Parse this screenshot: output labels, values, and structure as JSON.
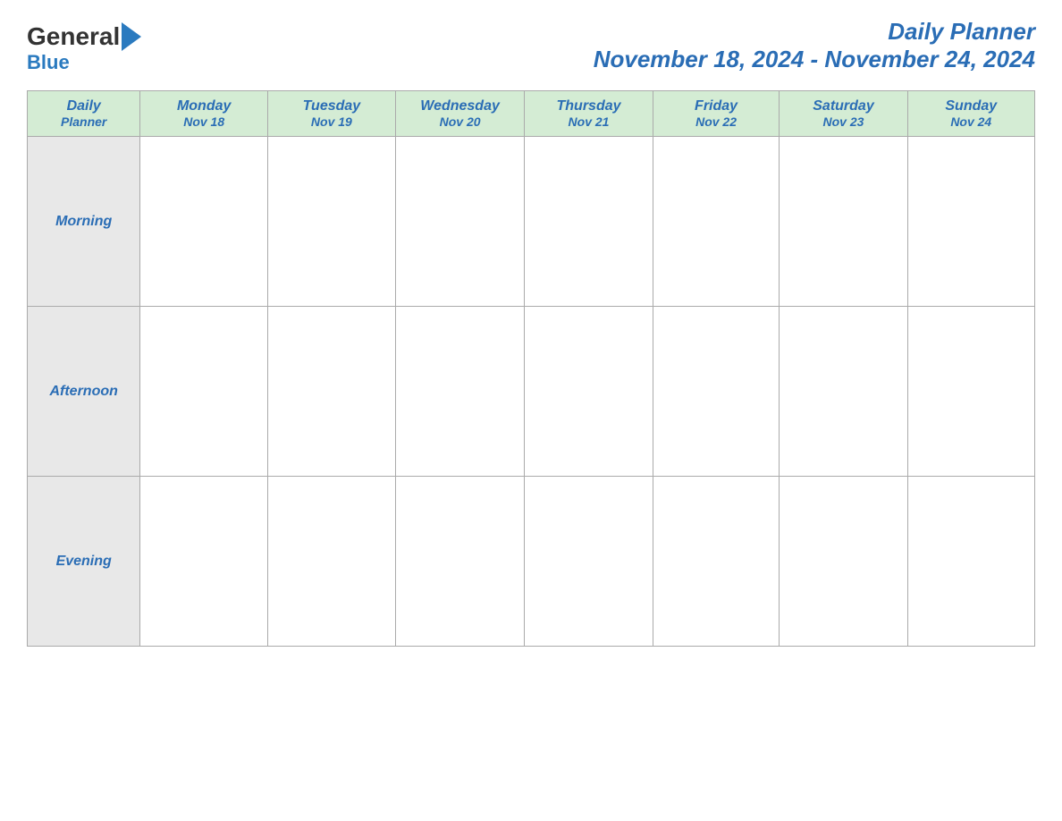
{
  "header": {
    "title": "Daily Planner",
    "date_range": "November 18, 2024 - November 24, 2024",
    "logo_general": "General",
    "logo_blue": "Blue"
  },
  "table": {
    "header": {
      "col0": {
        "line1": "Daily",
        "line2": "Planner"
      },
      "col1": {
        "line1": "Monday",
        "line2": "Nov 18"
      },
      "col2": {
        "line1": "Tuesday",
        "line2": "Nov 19"
      },
      "col3": {
        "line1": "Wednesday",
        "line2": "Nov 20"
      },
      "col4": {
        "line1": "Thursday",
        "line2": "Nov 21"
      },
      "col5": {
        "line1": "Friday",
        "line2": "Nov 22"
      },
      "col6": {
        "line1": "Saturday",
        "line2": "Nov 23"
      },
      "col7": {
        "line1": "Sunday",
        "line2": "Nov 24"
      }
    },
    "rows": [
      {
        "label": "Morning"
      },
      {
        "label": "Afternoon"
      },
      {
        "label": "Evening"
      }
    ]
  }
}
